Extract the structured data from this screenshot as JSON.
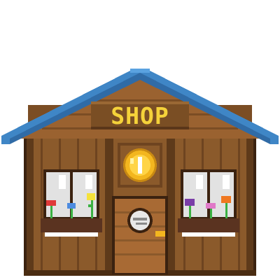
{
  "sign": {
    "text": "SHOP"
  },
  "colors": {
    "background": "#ffffff",
    "roof_blue": "#3f86c6",
    "roof_blue_dark": "#24568c",
    "wood": "#8b5a2b",
    "wood_light": "#a36a34",
    "wood_dark": "#5a3619",
    "outline": "#3b2210",
    "sign_board": "#7a4e24",
    "sign_text": "#f5d23a",
    "coin_gold": "#f3b61f",
    "coin_light": "#ffe066",
    "window_glass": "#e4e4e4",
    "window_shine": "#ffffff",
    "planter": "#5a3320",
    "stem_green": "#3bb143",
    "clock_face": "#e8e8e8",
    "door_handle": "#f3b61f"
  },
  "flowers_left": [
    "red",
    "blue",
    "yellow"
  ],
  "flowers_right": [
    "purple",
    "pink",
    "orange"
  ]
}
